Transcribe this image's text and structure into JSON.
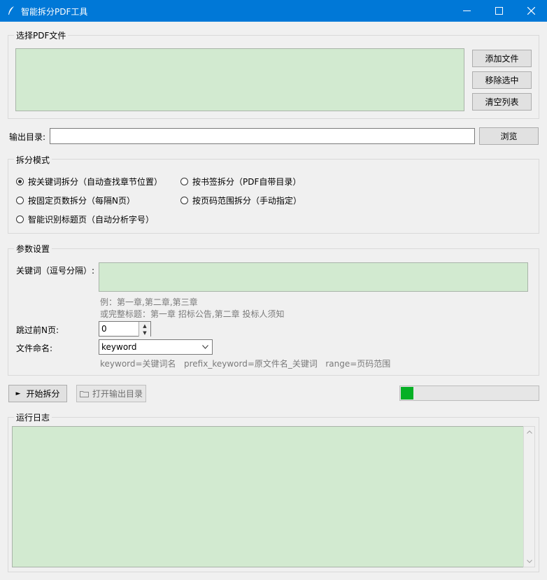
{
  "window": {
    "title": "智能拆分PDF工具"
  },
  "file_select": {
    "group_label": "选择PDF文件",
    "add_button": "添加文件",
    "remove_button": "移除选中",
    "clear_button": "清空列表"
  },
  "output": {
    "label": "输出目录:",
    "value": "",
    "browse_button": "浏览"
  },
  "split_mode": {
    "group_label": "拆分模式",
    "options": [
      {
        "label": "按关键词拆分（自动查找章节位置）",
        "selected": true
      },
      {
        "label": "按书签拆分（PDF自带目录）",
        "selected": false
      },
      {
        "label": "按固定页数拆分（每隔N页）",
        "selected": false
      },
      {
        "label": "按页码范围拆分（手动指定）",
        "selected": false
      },
      {
        "label": "智能识别标题页（自动分析字号）",
        "selected": false
      }
    ]
  },
  "params": {
    "group_label": "参数设置",
    "keyword_label": "关键词（逗号分隔）:",
    "keyword_value": "",
    "hint_line1": "例：第一章,第二章,第三章",
    "hint_line2": "或完整标题：第一章 招标公告,第二章 投标人须知",
    "skip_label": "跳过前N页:",
    "skip_value": "0",
    "naming_label": "文件命名:",
    "naming_value": "keyword",
    "naming_hint": "keyword=关键词名   prefix_keyword=原文件名_关键词   range=页码范围"
  },
  "actions": {
    "start_button": "开始拆分",
    "open_output_button": "打开输出目录",
    "progress_fraction": 0.09
  },
  "log": {
    "group_label": "运行日志"
  },
  "colors": {
    "titlebar": "#0078d7",
    "list_bg": "#d2ead0",
    "progress": "#06b025"
  }
}
